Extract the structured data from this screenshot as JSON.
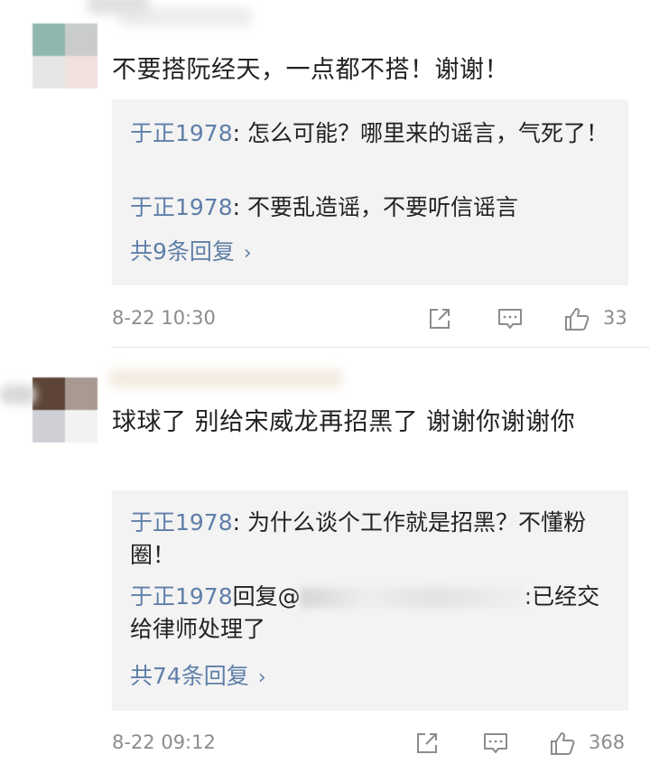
{
  "comments": [
    {
      "text": "不要搭阮经天，一点都不搭！谢谢！",
      "replies": [
        {
          "author": "于正1978",
          "text": ": 怎么可能？哪里来的谣言，气死了！"
        },
        {
          "author": "于正1978",
          "text": ": 不要乱造谣，不要听信谣言"
        }
      ],
      "more_replies": "共9条回复",
      "time": "8-22 10:30",
      "likes": "33",
      "icons": [
        "share-icon",
        "comment-icon",
        "like-icon"
      ]
    },
    {
      "text": "球球了 别给宋威龙再招黑了 谢谢你谢谢你",
      "replies": [
        {
          "author": "于正1978",
          "text": ": 为什么谈个工作就是招黑？不懂粉圈！"
        },
        {
          "author": "于正1978",
          "mid": "回复@",
          "text": ":已经交给律师处理了"
        }
      ],
      "more_replies": "共74条回复",
      "time": "8-22 09:12",
      "likes": "368",
      "icons": [
        "share-icon",
        "comment-icon",
        "like-icon"
      ]
    }
  ],
  "colors": {
    "link": "#5f7fa8",
    "meta": "#8c8c8c",
    "reply_bg": "#f3f3f3"
  }
}
